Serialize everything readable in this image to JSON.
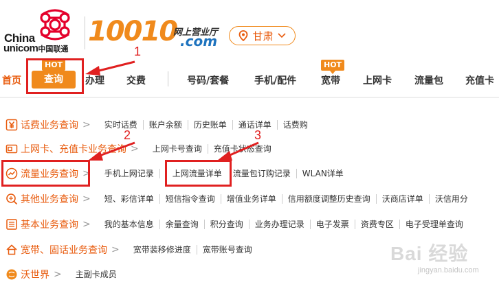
{
  "header": {
    "brand_china": "China",
    "brand_unicom": "unicom",
    "brand_unicom_cn": "中国联通",
    "number": "10010",
    "hall_cn": "网上营业厅",
    "dotcom": ".com",
    "region": "甘肃"
  },
  "nav": {
    "home": "首页",
    "query": "查询",
    "handle": "办理",
    "pay": "交费",
    "number_plan": "号码/套餐",
    "phone_parts": "手机/配件",
    "broadband": "宽带",
    "netcard": "上网卡",
    "data_pack": "流量包",
    "recharge": "充值卡",
    "hot_label": "HOT"
  },
  "annotations": {
    "one": "1",
    "two": "2",
    "three": "3"
  },
  "menu": {
    "rows": [
      {
        "category": "话费业务查询",
        "links": [
          "实时话费",
          "账户余额",
          "历史账单",
          "通话详单",
          "话费购"
        ]
      },
      {
        "category": "上网卡、充值卡业务查询",
        "links": [
          "上网卡号查询",
          "充值卡状态查询"
        ]
      },
      {
        "category": "流量业务查询",
        "links": [
          "手机上网记录",
          "上网流量详单",
          "流量包订购记录",
          "WLAN详单"
        ]
      },
      {
        "category": "其他业务查询",
        "links": [
          "短、彩信详单",
          "短信指令查询",
          "增值业务详单",
          "信用额度调整历史查询",
          "沃商店详单",
          "沃信用分"
        ]
      },
      {
        "category": "基本业务查询",
        "links": [
          "我的基本信息",
          "余量查询",
          "积分查询",
          "业务办理记录",
          "电子发票",
          "资费专区",
          "电子受理单查询"
        ]
      },
      {
        "category": "宽带、固话业务查询",
        "links": [
          "宽带装移修进度",
          "宽带账号查询"
        ]
      },
      {
        "category": "沃世界",
        "links": [
          "主副卡成员"
        ]
      }
    ],
    "chevron": ">"
  },
  "watermark": {
    "text": "Bai 经验",
    "url": "jingyan.baidu.com"
  },
  "colors": {
    "accent": "#f08a1c",
    "category": "#e85a0c",
    "annotation": "#e02020",
    "blue": "#1e73be"
  }
}
